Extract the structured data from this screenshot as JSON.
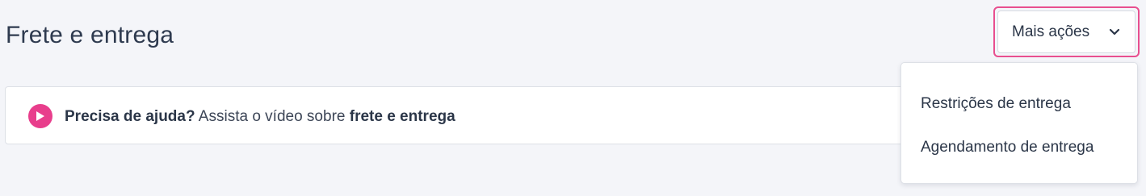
{
  "header": {
    "title": "Frete e entrega"
  },
  "help_banner": {
    "icon": "play-icon",
    "prefix_bold": "Precisa de ajuda?",
    "middle_text": " Assista o vídeo sobre ",
    "link_text": "frete e entrega",
    "icon_color": "#e83e8c"
  },
  "actions": {
    "button_label": "Mais ações",
    "button_icon": "chevron-down-icon",
    "focus_color": "#e84f8f",
    "menu_items": [
      {
        "label": "Restrições de entrega"
      },
      {
        "label": "Agendamento de entrega"
      }
    ]
  }
}
